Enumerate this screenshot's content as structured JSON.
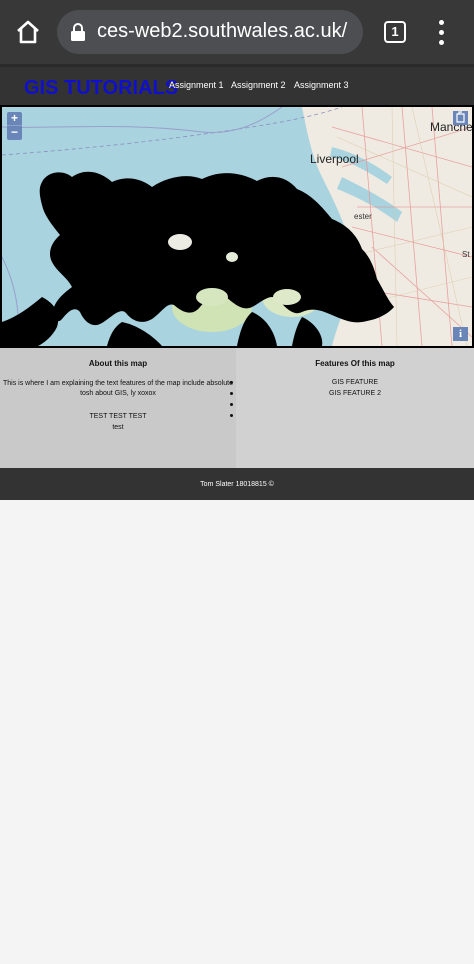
{
  "browser": {
    "url": "ces-web2.southwales.ac.uk/",
    "tab_count": "1",
    "icons": [
      "home-icon",
      "lock-icon",
      "tabs-icon",
      "more-vert-icon"
    ]
  },
  "site": {
    "title": "GIS TUTORIALS",
    "title_color": "#1010cc",
    "nav": [
      "Assignment 1",
      "Assignment 2",
      "Assignment 3"
    ]
  },
  "map": {
    "zoom_in": "+",
    "zoom_out": "−",
    "info": "i",
    "labels": [
      "Liverpool",
      "Manche",
      "ester",
      "St"
    ]
  },
  "about": {
    "title": "About this map",
    "text": "This is where I am explaining the text features of the map include absolute\ntosh about GIS, ly xoxox",
    "extra": [
      "TEST TEST TEST",
      "test"
    ]
  },
  "features": {
    "title": "Features Of this map",
    "items": [
      "GIS FEATURE",
      "GIS FEATURE 2"
    ]
  },
  "footer": {
    "text": "Tom Slater 18018815 ©"
  }
}
